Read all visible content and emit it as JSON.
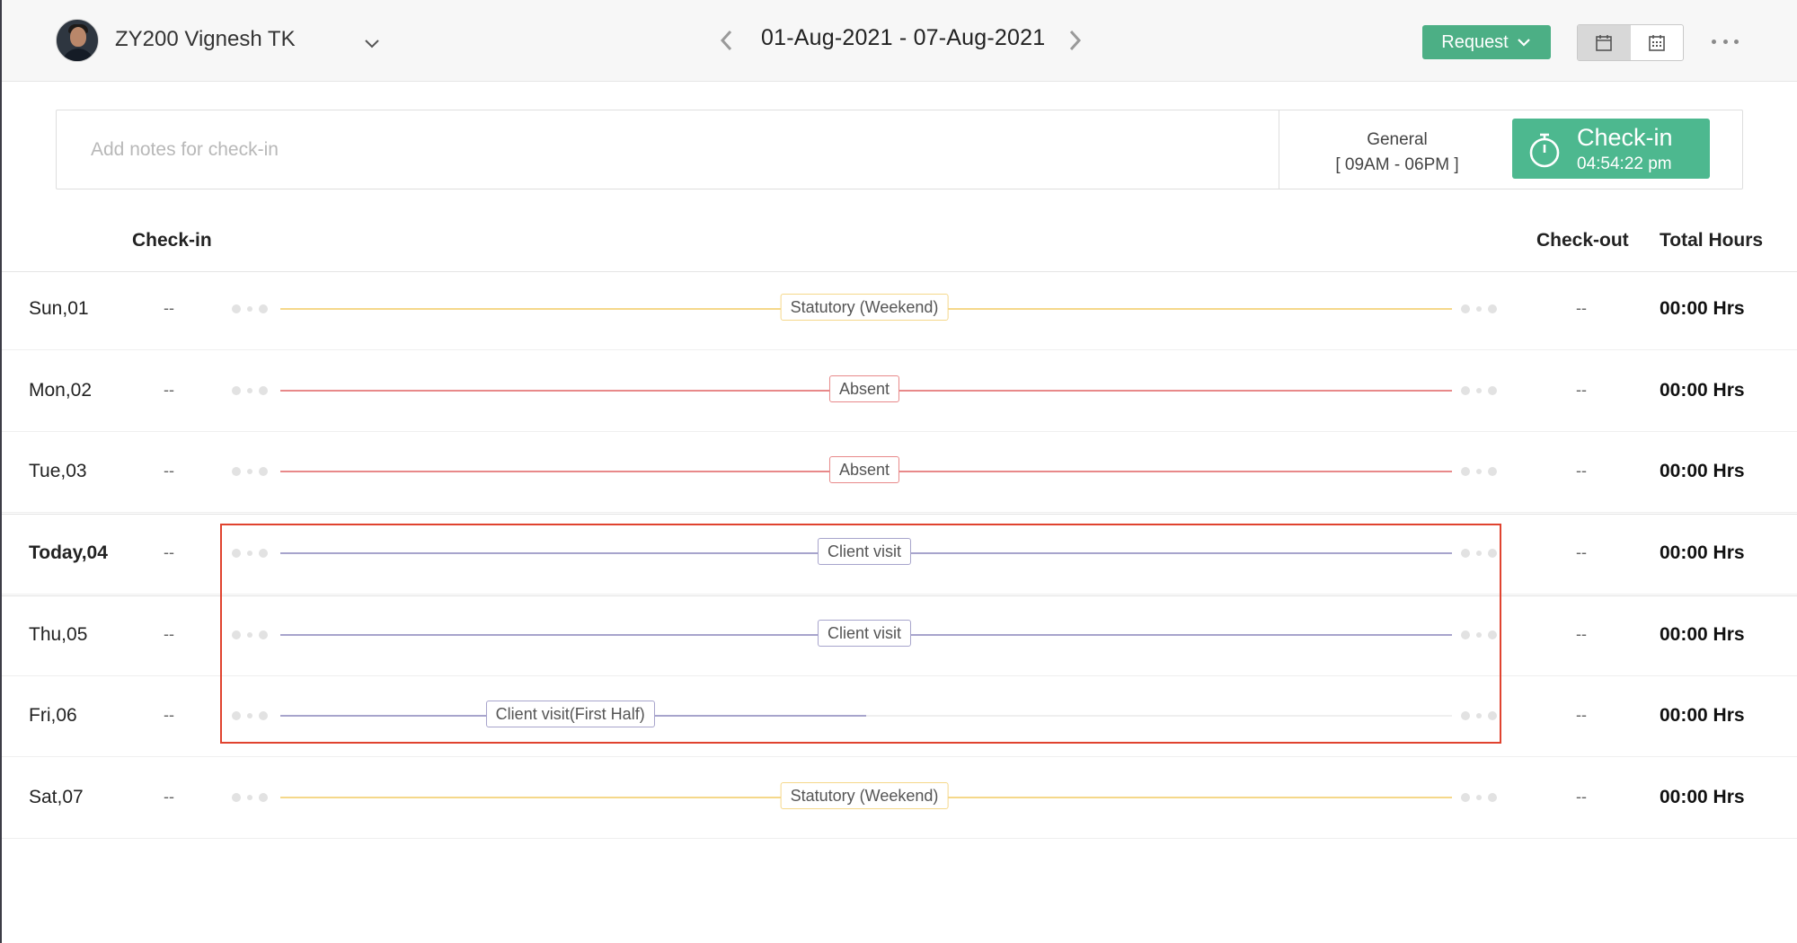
{
  "header": {
    "user_name": "ZY200 Vignesh TK",
    "date_range": "01-Aug-2021  -  07-Aug-2021",
    "request_label": "Request"
  },
  "checkin_panel": {
    "notes_placeholder": "Add notes for check-in",
    "shift_name": "General",
    "shift_hours": "[ 09AM - 06PM ]",
    "button_label": "Check-in",
    "button_time": "04:54:22 pm"
  },
  "columns": {
    "checkin": "Check-in",
    "checkout": "Check-out",
    "total_hours": "Total Hours"
  },
  "colors": {
    "accent_green": "#4caf85",
    "weekend": "#f5d88a",
    "absent": "#e8898a",
    "client_visit": "#a7a4cc",
    "highlight": "#e0432f"
  },
  "rows": [
    {
      "day": "Sun,01",
      "check_in": "--",
      "check_out": "--",
      "total": "00:00 Hrs",
      "status": "Statutory (Weekend)",
      "status_type": "weekend",
      "coverage": 1.0
    },
    {
      "day": "Mon,02",
      "check_in": "--",
      "check_out": "--",
      "total": "00:00 Hrs",
      "status": "Absent",
      "status_type": "absent",
      "coverage": 1.0
    },
    {
      "day": "Tue,03",
      "check_in": "--",
      "check_out": "--",
      "total": "00:00 Hrs",
      "status": "Absent",
      "status_type": "absent",
      "coverage": 1.0
    },
    {
      "day": "Today,04",
      "check_in": "--",
      "check_out": "--",
      "total": "00:00 Hrs",
      "status": "Client visit",
      "status_type": "client_visit",
      "coverage": 1.0,
      "today": true
    },
    {
      "day": "Thu,05",
      "check_in": "--",
      "check_out": "--",
      "total": "00:00 Hrs",
      "status": "Client visit",
      "status_type": "client_visit",
      "coverage": 1.0
    },
    {
      "day": "Fri,06",
      "check_in": "--",
      "check_out": "--",
      "total": "00:00 Hrs",
      "status": "Client visit(First Half)",
      "status_type": "client_visit",
      "coverage": 0.5
    },
    {
      "day": "Sat,07",
      "check_in": "--",
      "check_out": "--",
      "total": "00:00 Hrs",
      "status": "Statutory (Weekend)",
      "status_type": "weekend",
      "coverage": 1.0
    }
  ]
}
